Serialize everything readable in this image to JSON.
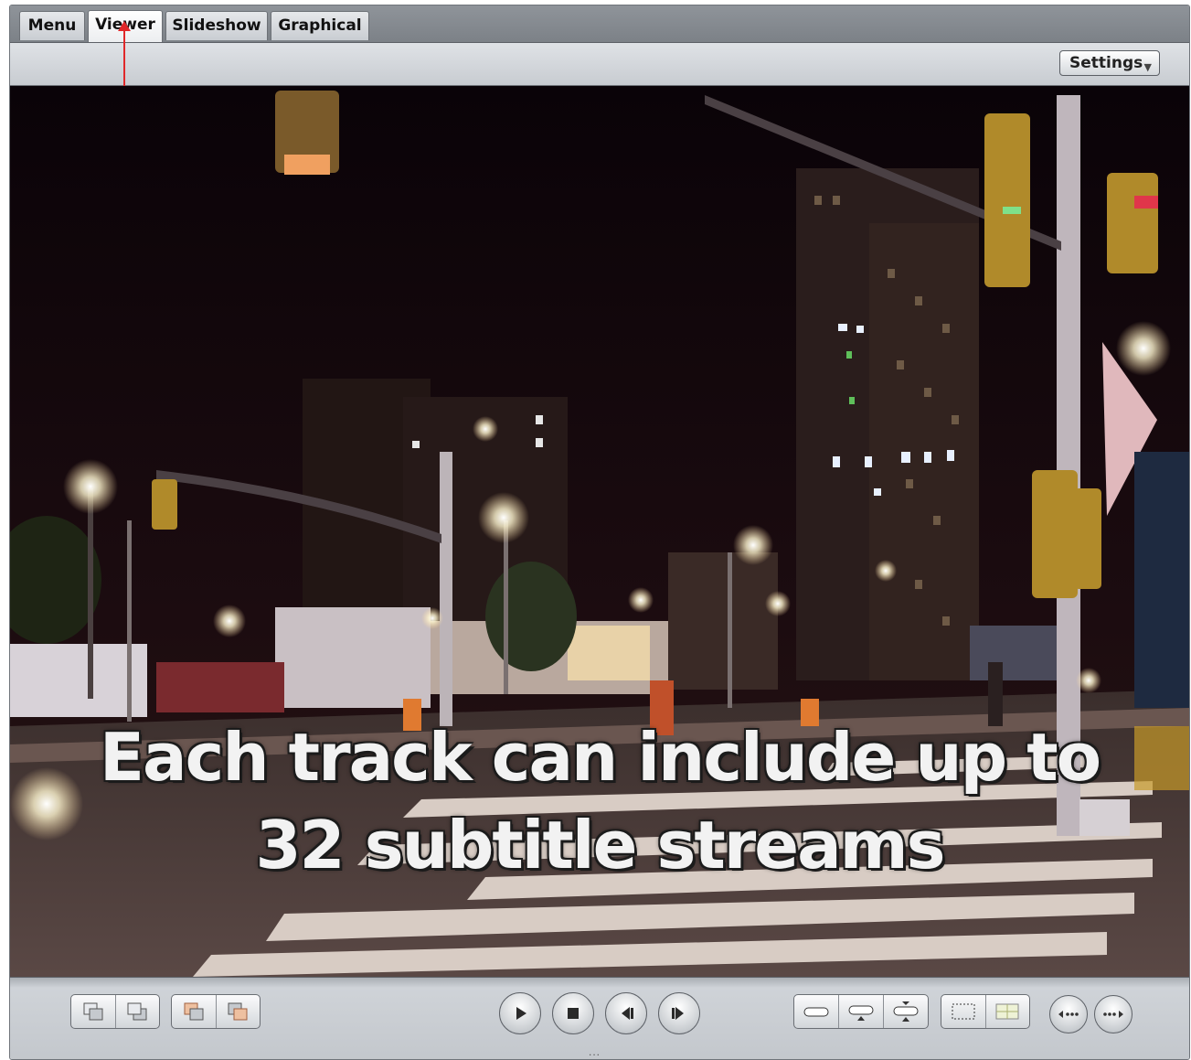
{
  "tabs": [
    {
      "label": "Menu",
      "active": false
    },
    {
      "label": "Viewer",
      "active": true
    },
    {
      "label": "Slideshow",
      "active": false
    },
    {
      "label": "Graphical",
      "active": false
    }
  ],
  "toolbar": {
    "settings_label": "Settings"
  },
  "viewer": {
    "subtitle": "Each track can include up to\n32 subtitle streams"
  },
  "controls": {
    "left_group_a": [
      "overlay-back-icon",
      "overlay-front-icon"
    ],
    "left_group_b": [
      "subtitle-back-icon",
      "subtitle-front-icon"
    ],
    "transport": [
      "play-icon",
      "stop-icon",
      "step-back-icon",
      "step-forward-icon"
    ],
    "right_group_a": [
      "subtitle-bottom-icon",
      "subtitle-center-icon",
      "subtitle-top-icon"
    ],
    "right_group_b": [
      "title-safe-icon",
      "action-safe-icon"
    ],
    "nav_buttons": [
      "previous-stream-icon",
      "next-stream-icon"
    ],
    "grip": "..."
  },
  "colors": {
    "annotation_arrow": "#e0282a",
    "tab_bar": "#868b91",
    "viewer_bg": "#0b0409"
  }
}
